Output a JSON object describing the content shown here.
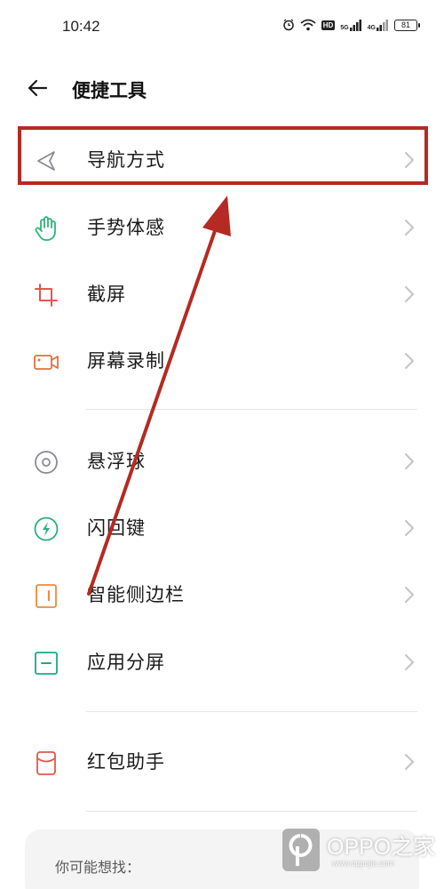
{
  "status_bar": {
    "time": "10:42",
    "hd_label": "HD",
    "net1_label": "5G",
    "net2_label": "4G",
    "battery": "81"
  },
  "header": {
    "back_icon": "arrow-left-icon",
    "title": "便捷工具"
  },
  "items": [
    {
      "label": "导航方式",
      "icon": "navigation-arrow-icon",
      "color": "#8a8a96",
      "highlighted": true
    },
    {
      "label": "手势体感",
      "icon": "hand-gesture-icon",
      "color": "#2fb57a"
    },
    {
      "label": "截屏",
      "icon": "crop-screenshot-icon",
      "color": "#e0584c"
    },
    {
      "label": "屏幕录制",
      "icon": "video-record-icon",
      "color": "#e36f3f"
    },
    {
      "label": "悬浮球",
      "icon": "floating-ball-icon",
      "color": "#8a8a96"
    },
    {
      "label": "闪回键",
      "icon": "flash-bolt-icon",
      "color": "#26b07a"
    },
    {
      "label": "智能侧边栏",
      "icon": "sidebar-panel-icon",
      "color": "#ef8a3e"
    },
    {
      "label": "应用分屏",
      "icon": "split-screen-icon",
      "color": "#1ba88c"
    },
    {
      "label": "红包助手",
      "icon": "red-envelope-icon",
      "color": "#e0584c"
    }
  ],
  "suggestions": {
    "title": "你可能想找："
  },
  "annotation": {
    "highlight_color": "#b52a22"
  },
  "watermark": {
    "text": "OPPO之家",
    "url": "www.oppojia.com"
  }
}
